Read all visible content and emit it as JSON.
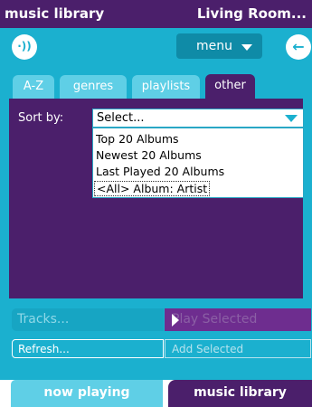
{
  "title_bar": {
    "left": "music library",
    "right": "Living Room..."
  },
  "toolbar": {
    "speaker_icon": "speaker-icon",
    "menu_label": "menu",
    "back_icon": "back-arrow-icon"
  },
  "tabs": [
    {
      "label": "A-Z",
      "active": false
    },
    {
      "label": "genres",
      "active": false
    },
    {
      "label": "playlists",
      "active": false
    },
    {
      "label": "other",
      "active": true
    }
  ],
  "sort": {
    "label": "Sort by:",
    "selected": "Select...",
    "options": [
      "Top 20 Albums",
      "Newest 20 Albums",
      "Last Played 20 Albums",
      "<All> Album: Artist"
    ]
  },
  "actions": {
    "tracks": "Tracks...",
    "play_selected": "Play Selected",
    "refresh": "Refresh...",
    "add_selected": "Add Selected"
  },
  "bottom_tabs": {
    "now_playing": "now playing",
    "music_library": "music library"
  },
  "colors": {
    "purple": "#4b1f6b",
    "teal": "#1bb0cf",
    "light_teal": "#5fcfe6"
  }
}
